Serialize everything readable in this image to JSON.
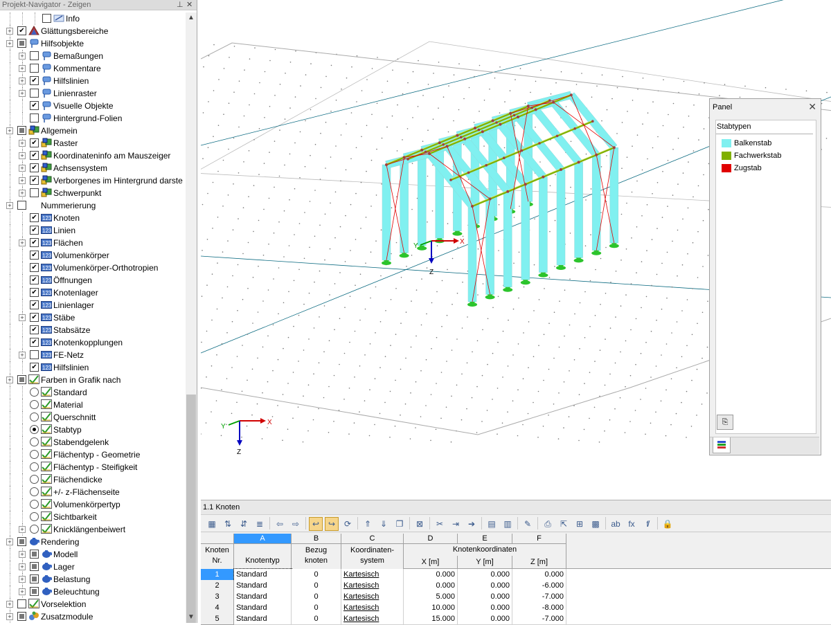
{
  "navigator": {
    "title": "Projekt-Navigator - Zeigen",
    "pin_icon": "pin-icon",
    "close_icon": "close-icon",
    "items": [
      {
        "label": "Info",
        "depth": 2,
        "check": "off",
        "icon": "info-icon",
        "expander": false
      },
      {
        "label": "Glättungsbereiche",
        "depth": 0,
        "check": "on",
        "icon": "smoothing-icon",
        "expander": true
      },
      {
        "label": "Hilfsobjekte",
        "depth": 0,
        "check": "part",
        "icon": "pin-flag-icon",
        "expander": true
      },
      {
        "label": "Bemaßungen",
        "depth": 1,
        "check": "off",
        "icon": "pin-flag-icon",
        "expander": true
      },
      {
        "label": "Kommentare",
        "depth": 1,
        "check": "off",
        "icon": "pin-flag-icon",
        "expander": true
      },
      {
        "label": "Hilfslinien",
        "depth": 1,
        "check": "on",
        "icon": "pin-flag-icon",
        "expander": true
      },
      {
        "label": "Linienraster",
        "depth": 1,
        "check": "off",
        "icon": "pin-flag-icon",
        "expander": true
      },
      {
        "label": "Visuelle Objekte",
        "depth": 1,
        "check": "on",
        "icon": "pin-flag-icon",
        "expander": false
      },
      {
        "label": "Hintergrund-Folien",
        "depth": 1,
        "check": "off",
        "icon": "pin-flag-icon",
        "expander": false
      },
      {
        "label": "Allgemein",
        "depth": 0,
        "check": "part",
        "icon": "general-icon",
        "expander": true
      },
      {
        "label": "Raster",
        "depth": 1,
        "check": "on",
        "icon": "general-icon",
        "expander": true
      },
      {
        "label": "Koordinateninfo am Mauszeiger",
        "depth": 1,
        "check": "on",
        "icon": "general-icon",
        "expander": true
      },
      {
        "label": "Achsensystem",
        "depth": 1,
        "check": "on",
        "icon": "general-icon",
        "expander": true
      },
      {
        "label": "Verborgenes im Hintergrund darste",
        "depth": 1,
        "check": "on",
        "icon": "general-icon",
        "expander": true
      },
      {
        "label": "Schwerpunkt",
        "depth": 1,
        "check": "off",
        "icon": "general-icon",
        "expander": true
      },
      {
        "label": "Nummerierung",
        "depth": 0,
        "check": "off",
        "icon": "",
        "expander": true
      },
      {
        "label": "Knoten",
        "depth": 1,
        "check": "on",
        "icon": "numbering-icon",
        "expander": false
      },
      {
        "label": "Linien",
        "depth": 1,
        "check": "on",
        "icon": "numbering-icon",
        "expander": false
      },
      {
        "label": "Flächen",
        "depth": 1,
        "check": "on",
        "icon": "numbering-icon",
        "expander": true
      },
      {
        "label": "Volumenkörper",
        "depth": 1,
        "check": "on",
        "icon": "numbering-icon",
        "expander": false
      },
      {
        "label": "Volumenkörper-Orthotropien",
        "depth": 1,
        "check": "on",
        "icon": "numbering-icon",
        "expander": false
      },
      {
        "label": "Öffnungen",
        "depth": 1,
        "check": "on",
        "icon": "numbering-icon",
        "expander": false
      },
      {
        "label": "Knotenlager",
        "depth": 1,
        "check": "on",
        "icon": "numbering-icon",
        "expander": false
      },
      {
        "label": "Linienlager",
        "depth": 1,
        "check": "on",
        "icon": "numbering-icon",
        "expander": false
      },
      {
        "label": "Stäbe",
        "depth": 1,
        "check": "on",
        "icon": "numbering-icon",
        "expander": true
      },
      {
        "label": "Stabsätze",
        "depth": 1,
        "check": "on",
        "icon": "numbering-icon",
        "expander": false
      },
      {
        "label": "Knotenkopplungen",
        "depth": 1,
        "check": "on",
        "icon": "numbering-icon",
        "expander": false
      },
      {
        "label": "FE-Netz",
        "depth": 1,
        "check": "off",
        "icon": "numbering-icon",
        "expander": true
      },
      {
        "label": "Hilfslinien",
        "depth": 1,
        "check": "on",
        "icon": "numbering-icon",
        "expander": false
      },
      {
        "label": "Farben in Grafik nach",
        "depth": 0,
        "check": "part",
        "icon": "color-icon",
        "expander": true
      },
      {
        "label": "Standard",
        "depth": 1,
        "radio": "off",
        "icon": "color-icon",
        "expander": false
      },
      {
        "label": "Material",
        "depth": 1,
        "radio": "off",
        "icon": "color-icon",
        "expander": false
      },
      {
        "label": "Querschnitt",
        "depth": 1,
        "radio": "off",
        "icon": "color-icon",
        "expander": false
      },
      {
        "label": "Stabtyp",
        "depth": 1,
        "radio": "on",
        "icon": "color-icon",
        "expander": false
      },
      {
        "label": "Stabendgelenk",
        "depth": 1,
        "radio": "off",
        "icon": "color-icon",
        "expander": false
      },
      {
        "label": "Flächentyp - Geometrie",
        "depth": 1,
        "radio": "off",
        "icon": "color-icon",
        "expander": false
      },
      {
        "label": "Flächentyp - Steifigkeit",
        "depth": 1,
        "radio": "off",
        "icon": "color-icon",
        "expander": false
      },
      {
        "label": "Flächendicke",
        "depth": 1,
        "radio": "off",
        "icon": "color-icon",
        "expander": false
      },
      {
        "label": "+/- z-Flächenseite",
        "depth": 1,
        "radio": "off",
        "icon": "color-icon",
        "expander": false
      },
      {
        "label": "Volumenkörpertyp",
        "depth": 1,
        "radio": "off",
        "icon": "color-icon",
        "expander": false
      },
      {
        "label": "Sichtbarkeit",
        "depth": 1,
        "radio": "off",
        "icon": "color-icon",
        "expander": false
      },
      {
        "label": "Knicklängenbeiwert",
        "depth": 1,
        "radio": "off",
        "icon": "color-icon",
        "expander": true
      },
      {
        "label": "Rendering",
        "depth": 0,
        "check": "part",
        "icon": "teapot-icon",
        "expander": true
      },
      {
        "label": "Modell",
        "depth": 1,
        "check": "part",
        "icon": "teapot-icon",
        "expander": true
      },
      {
        "label": "Lager",
        "depth": 1,
        "check": "part",
        "icon": "teapot-icon",
        "expander": true
      },
      {
        "label": "Belastung",
        "depth": 1,
        "check": "part",
        "icon": "teapot-icon",
        "expander": true
      },
      {
        "label": "Beleuchtung",
        "depth": 1,
        "check": "part",
        "icon": "teapot-icon",
        "expander": true
      },
      {
        "label": "Vorselektion",
        "depth": 0,
        "check": "off",
        "icon": "color-icon",
        "expander": true
      },
      {
        "label": "Zusatzmodule",
        "depth": 0,
        "check": "part",
        "icon": "modules-icon",
        "expander": true
      }
    ]
  },
  "viewport": {
    "axis_labels": {
      "x": "X",
      "y": "Y",
      "z": "Z"
    },
    "center_axis_labels": {
      "x": "X",
      "y": "Y",
      "z": "Z"
    }
  },
  "panel": {
    "title": "Panel",
    "section_title": "Stabtypen",
    "legend": [
      {
        "label": "Balkenstab",
        "color": "#80f0f0"
      },
      {
        "label": "Fachwerkstab",
        "color": "#80b000"
      },
      {
        "label": "Zugstab",
        "color": "#e00000"
      }
    ]
  },
  "table": {
    "title": "1.1 Knoten",
    "col_letters": [
      "A",
      "B",
      "C",
      "D",
      "E",
      "F"
    ],
    "header_row1": {
      "rownr": "Knoten",
      "b": "Bezug",
      "c": "Koordinaten-",
      "group": "Knotenkoordinaten"
    },
    "header_row2": {
      "rownr": "Nr.",
      "a": "Knotentyp",
      "b": "knoten",
      "c": "system",
      "d": "X [m]",
      "e": "Y [m]",
      "f": "Z [m]"
    },
    "rows": [
      {
        "nr": "1",
        "typ": "Standard",
        "bezug": "0",
        "system": "Kartesisch",
        "x": "0.000",
        "y": "0.000",
        "z": "0.000"
      },
      {
        "nr": "2",
        "typ": "Standard",
        "bezug": "0",
        "system": "Kartesisch",
        "x": "0.000",
        "y": "0.000",
        "z": "-6.000"
      },
      {
        "nr": "3",
        "typ": "Standard",
        "bezug": "0",
        "system": "Kartesisch",
        "x": "5.000",
        "y": "0.000",
        "z": "-7.000"
      },
      {
        "nr": "4",
        "typ": "Standard",
        "bezug": "0",
        "system": "Kartesisch",
        "x": "10.000",
        "y": "0.000",
        "z": "-8.000"
      },
      {
        "nr": "5",
        "typ": "Standard",
        "bezug": "0",
        "system": "Kartesisch",
        "x": "15.000",
        "y": "0.000",
        "z": "-7.000"
      }
    ]
  },
  "colors": {
    "beam": "#80f0f0",
    "truss": "#80b000",
    "tension": "#e00000",
    "support": "#2cc42c",
    "selection": "#3399ff"
  }
}
